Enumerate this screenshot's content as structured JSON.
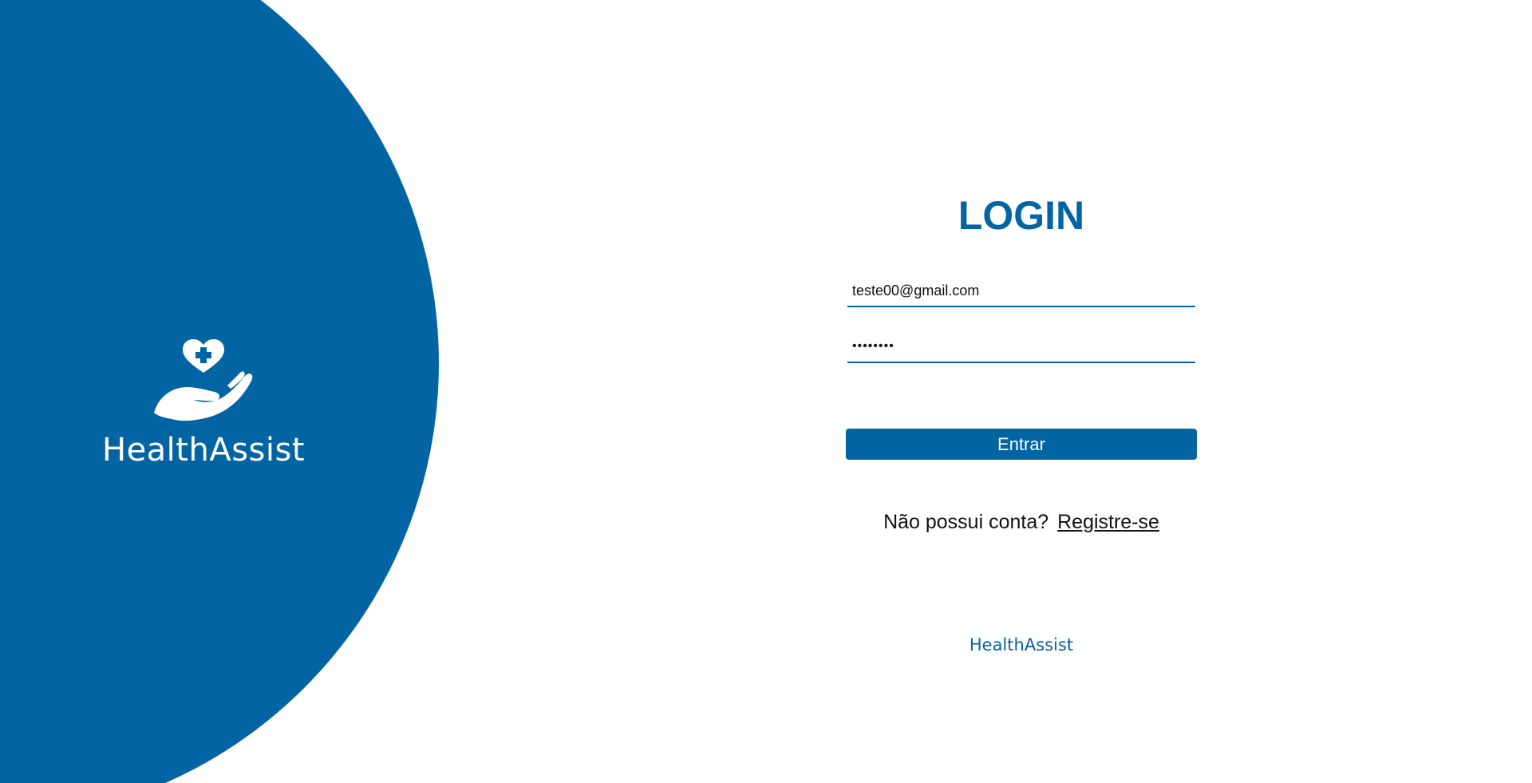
{
  "brand": {
    "name": "HealthAssist",
    "logo_icon": "heart-hand-icon",
    "primary_color": "#0364a3"
  },
  "login": {
    "title": "LOGIN",
    "email_value": "teste00@gmail.com",
    "password_value": "12345678",
    "submit_label": "Entrar",
    "register_prompt": "Não possui conta?",
    "register_link": "Registre-se"
  },
  "footer": {
    "brand_name": "HealthAssist"
  }
}
